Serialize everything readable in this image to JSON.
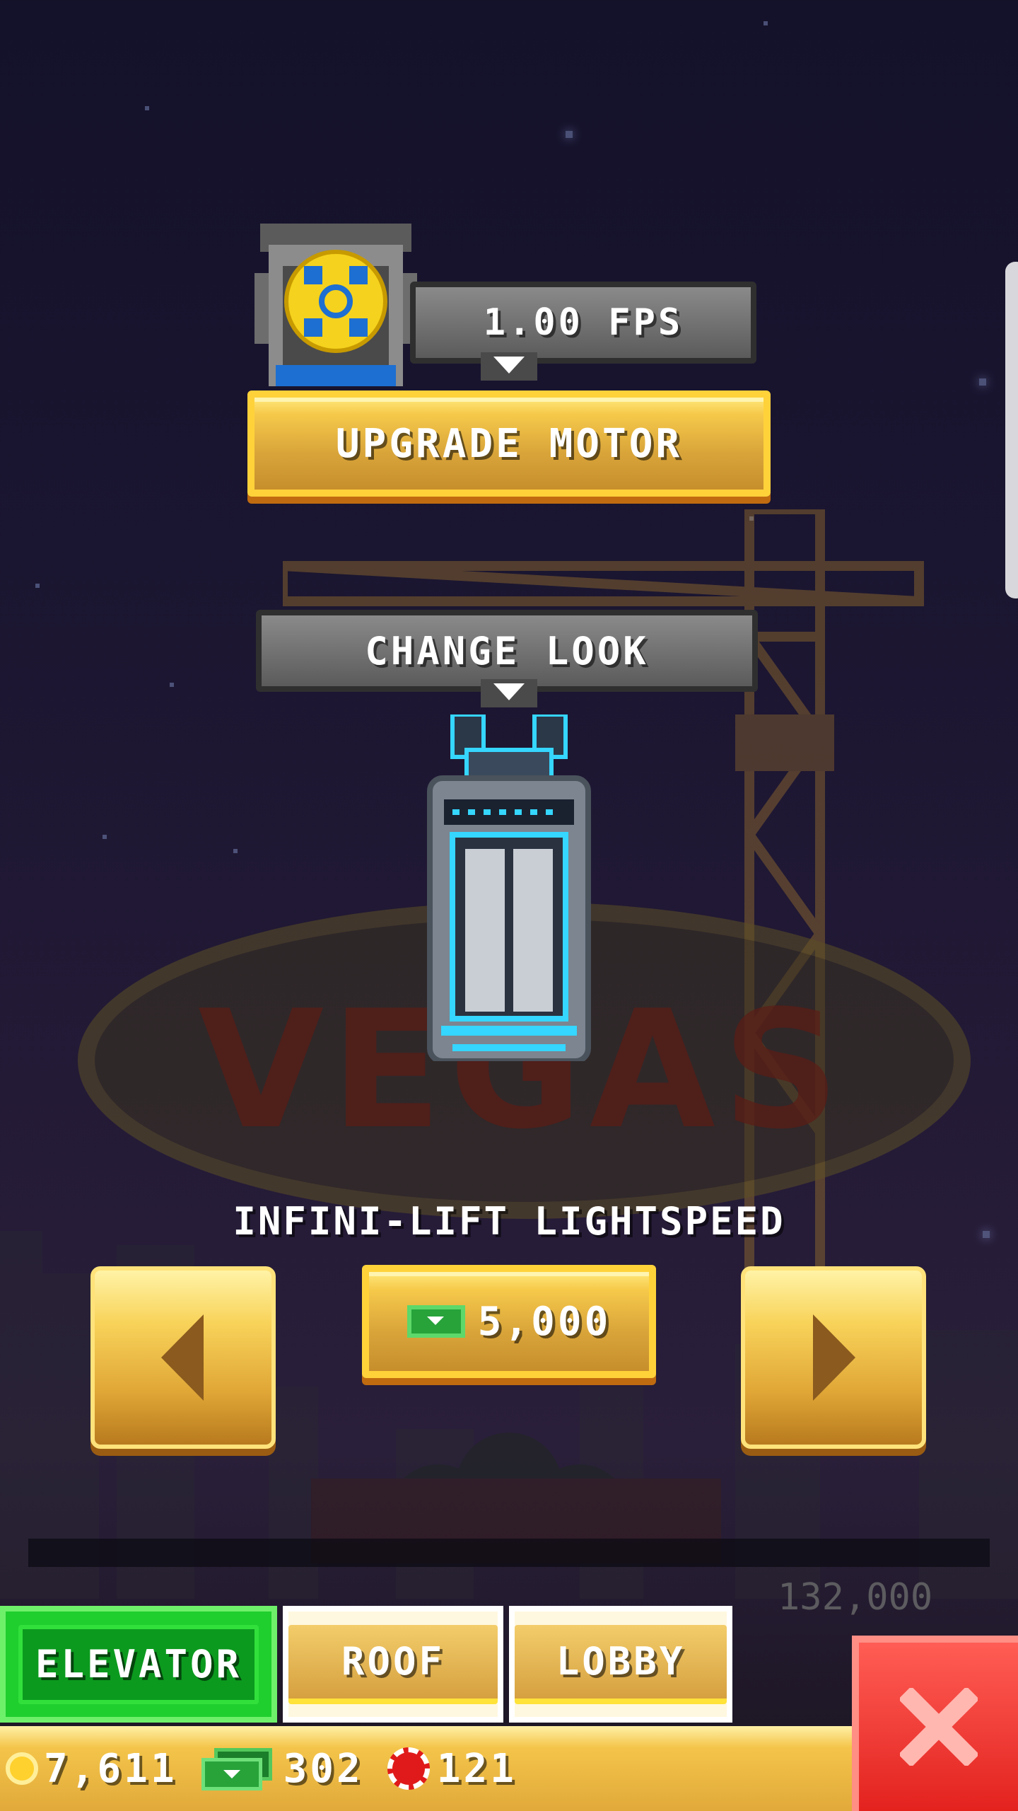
{
  "motor": {
    "speed_label": "1.00 FPS",
    "upgrade_label": "UPGRADE MOTOR"
  },
  "look": {
    "change_look_label": "CHANGE LOOK",
    "elevator_name": "INFINI-LIFT LIGHTSPEED",
    "price": "5,000"
  },
  "scenery": {
    "sign_text": "VEGAS",
    "floor_value": "132,000"
  },
  "tabs": [
    {
      "label": "ELEVATOR",
      "active": true
    },
    {
      "label": "ROOF",
      "active": false
    },
    {
      "label": "LOBBY",
      "active": false
    }
  ],
  "currency": {
    "coins": "7,611",
    "bux": "302",
    "chips": "121"
  },
  "icons": {
    "motor": "motor-wheel-icon",
    "prev": "left-arrow-icon",
    "next": "right-arrow-icon",
    "close": "close-x-icon",
    "coin": "coin-icon",
    "bux": "bux-icon",
    "chip": "vip-chip-icon"
  },
  "colors": {
    "active_tab": "#1fcf2e",
    "gold": "#f4c54a",
    "close": "#e3221e",
    "elevator_neon": "#35d6ff"
  }
}
